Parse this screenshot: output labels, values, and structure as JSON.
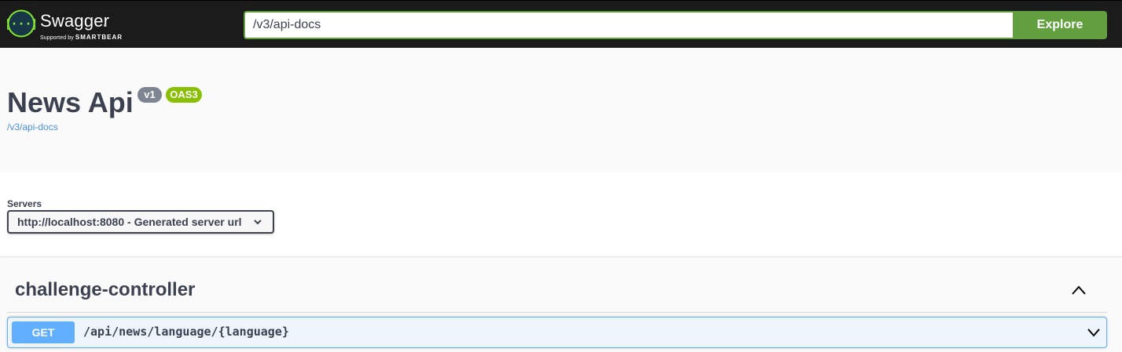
{
  "topbar": {
    "brand_name": "Swagger",
    "brand_sub_prefix": "Supported by",
    "brand_sub_company": "SMARTBEAR",
    "url_value": "/v3/api-docs",
    "explore_label": "Explore",
    "logo_icon": "swagger-braces-icon",
    "accent_color": "#62a03f"
  },
  "info": {
    "title": "News Api",
    "version_badge": "v1",
    "oas_badge": "OAS3",
    "spec_link": "/v3/api-docs"
  },
  "servers": {
    "label": "Servers",
    "selected": "http://localhost:8080 - Generated server url"
  },
  "operations": {
    "tag": "challenge-controller",
    "items": [
      {
        "method": "GET",
        "path": "/api/news/language/{language}",
        "method_color": "#61affe"
      }
    ]
  }
}
